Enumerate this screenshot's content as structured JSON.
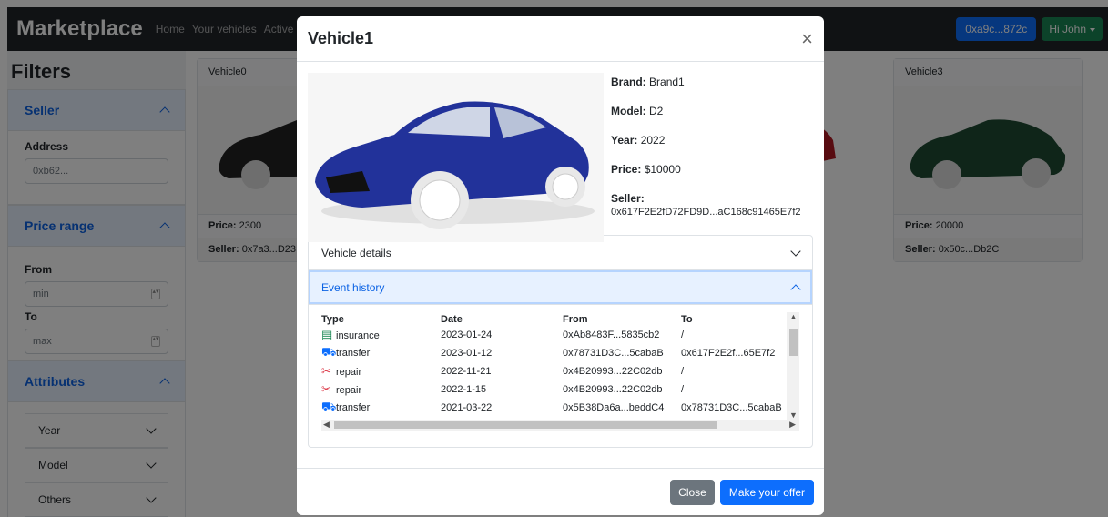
{
  "navbar": {
    "brand": "Marketplace",
    "links": [
      "Home",
      "Your vehicles",
      "Active"
    ],
    "address_button": "0xa9c...872c",
    "user_button": "Hi John"
  },
  "sidebar": {
    "title": "Filters",
    "seller": {
      "header": "Seller",
      "address_label": "Address",
      "address_value": "0xb62..."
    },
    "price": {
      "header": "Price range",
      "from_label": "From",
      "from_placeholder": "min",
      "to_label": "To",
      "to_placeholder": "max"
    },
    "attributes": {
      "header": "Attributes",
      "items": [
        "Year",
        "Model",
        "Others"
      ]
    }
  },
  "cards": [
    {
      "title": "Vehicle0",
      "price_label": "Price:",
      "price": "2300",
      "seller_label": "Seller:",
      "seller": "0x7a3...D23"
    },
    {
      "title": "Vehicle3",
      "price_label": "Price:",
      "price": "20000",
      "seller_label": "Seller:",
      "seller": "0x50c...Db2C"
    }
  ],
  "modal": {
    "title": "Vehicle1",
    "brand_label": "Brand:",
    "brand": "Brand1",
    "model_label": "Model:",
    "model": "D2",
    "year_label": "Year:",
    "year": "2022",
    "price_label": "Price:",
    "price": "$10000",
    "seller_label": "Seller:",
    "seller": "0x617F2E2fD72FD9D...aC168c91465E7f2",
    "details_header": "Vehicle details",
    "history_header": "Event history",
    "table": {
      "headers": [
        "Type",
        "Date",
        "From",
        "To"
      ],
      "rows": [
        {
          "icon": "receipt-icon",
          "type": "insurance",
          "date": "2023-01-24",
          "from": "0xAb8483F...5835cb2",
          "to": "/"
        },
        {
          "icon": "cart-icon",
          "type": "transfer",
          "date": "2023-01-12",
          "from": "0x78731D3C...5cabaB",
          "to": "0x617F2E2f...65E7f2"
        },
        {
          "icon": "tools-icon",
          "type": "repair",
          "date": "2022-11-21",
          "from": "0x4B20993...22C02db",
          "to": "/"
        },
        {
          "icon": "tools-icon",
          "type": "repair",
          "date": "2022-1-15",
          "from": "0x4B20993...22C02db",
          "to": "/"
        },
        {
          "icon": "cart-icon",
          "type": "transfer",
          "date": "2021-03-22",
          "from": "0x5B38Da6a...beddC4",
          "to": "0x78731D3C...5cabaB"
        }
      ]
    },
    "close_button": "Close",
    "offer_button": "Make your offer"
  },
  "colors": {
    "primary": "#0d6efd",
    "success": "#198754",
    "secondary": "#6c757d",
    "car_blue": "#22329a",
    "car_green": "#1f4a33",
    "car_black": "#222222",
    "car_red": "#b01822"
  }
}
